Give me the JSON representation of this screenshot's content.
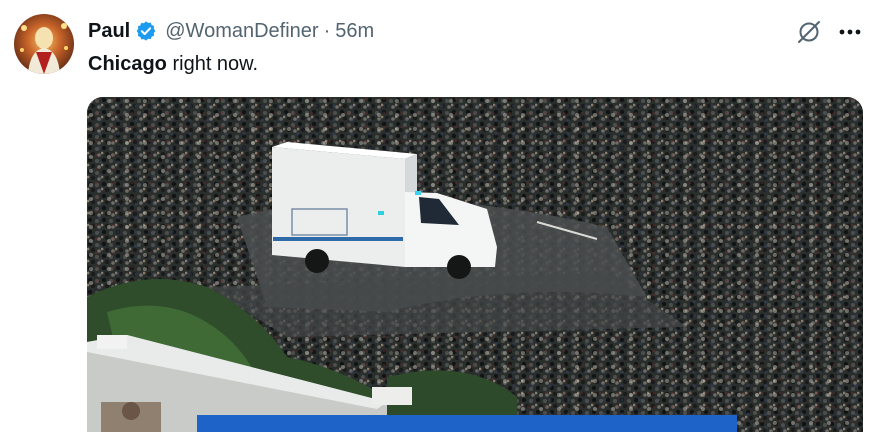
{
  "tweet": {
    "author_name": "Paul",
    "handle": "@WomanDefiner",
    "separator": "·",
    "time": "56m",
    "text_bold": "Chicago",
    "text_rest": " right now."
  },
  "icons": {
    "verified": "verified-badge-icon",
    "grok": "grok-icon",
    "more": "more-options-icon"
  },
  "colors": {
    "verified_blue": "#1d9bf0",
    "secondary_text": "#536471",
    "primary_text": "#0f1419"
  }
}
